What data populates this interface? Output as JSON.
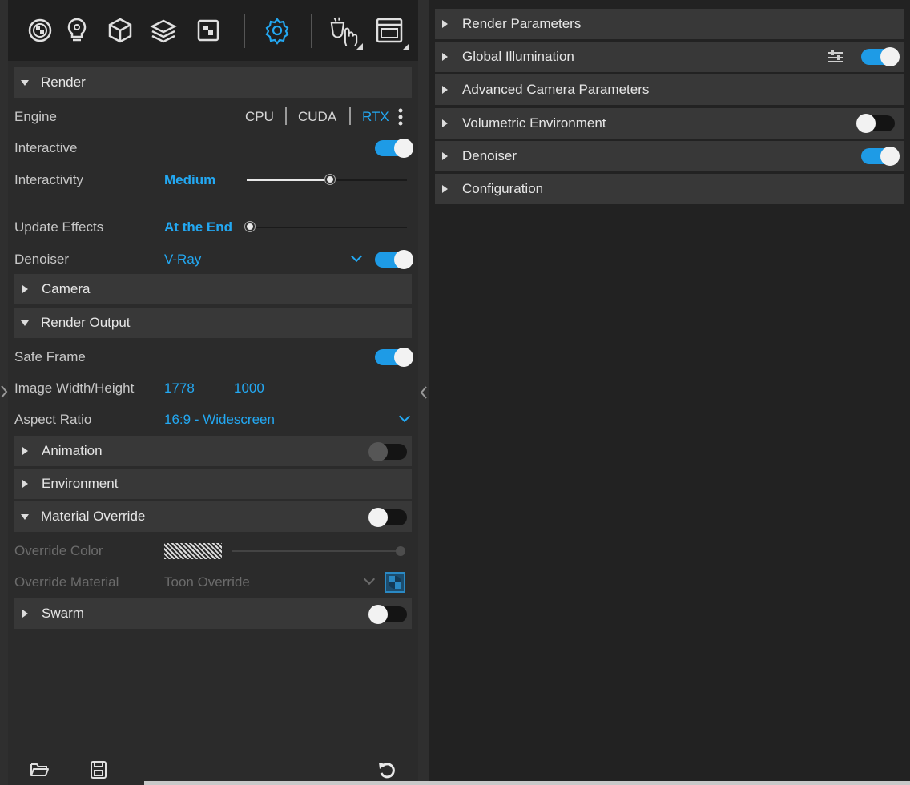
{
  "toolbar": {
    "icons": [
      "materials-icon",
      "lights-icon",
      "geometry-icon",
      "layers-icon",
      "textures-icon",
      "settings-icon",
      "render-interactive-icon",
      "frame-buffer-icon"
    ]
  },
  "render_section": {
    "title": "Render",
    "engine": {
      "label": "Engine",
      "options": [
        "CPU",
        "CUDA",
        "RTX"
      ],
      "selected": "RTX"
    },
    "interactive": {
      "label": "Interactive",
      "on": true
    },
    "interactivity": {
      "label": "Interactivity",
      "value": "Medium",
      "level": 0.52
    },
    "update_effects": {
      "label": "Update Effects",
      "value": "At the End",
      "level": 0.0
    },
    "denoiser": {
      "label": "Denoiser",
      "value": "V-Ray",
      "on": true
    }
  },
  "camera_section": {
    "title": "Camera"
  },
  "render_output_section": {
    "title": "Render Output",
    "safe_frame": {
      "label": "Safe Frame",
      "on": true
    },
    "image_size": {
      "label": "Image Width/Height",
      "width": "1778",
      "height": "1000"
    },
    "aspect_ratio": {
      "label": "Aspect Ratio",
      "value": "16:9 - Widescreen"
    }
  },
  "animation_section": {
    "title": "Animation",
    "on": false
  },
  "environment_section": {
    "title": "Environment"
  },
  "material_override_section": {
    "title": "Material Override",
    "on": false,
    "override_color": {
      "label": "Override Color"
    },
    "override_material": {
      "label": "Override Material",
      "value": "Toon Override"
    }
  },
  "swarm_section": {
    "title": "Swarm",
    "on": false
  },
  "right_sections": [
    {
      "title": "Render Parameters"
    },
    {
      "title": "Global Illumination",
      "on": true
    },
    {
      "title": "Advanced Camera Parameters"
    },
    {
      "title": "Volumetric Environment",
      "on": false
    },
    {
      "title": "Denoiser",
      "on": true
    },
    {
      "title": "Configuration"
    }
  ],
  "colors": {
    "accent": "#23a8f2",
    "toggle_on": "#1e9be6",
    "panel": "#2b2b2b",
    "header": "#383838"
  }
}
